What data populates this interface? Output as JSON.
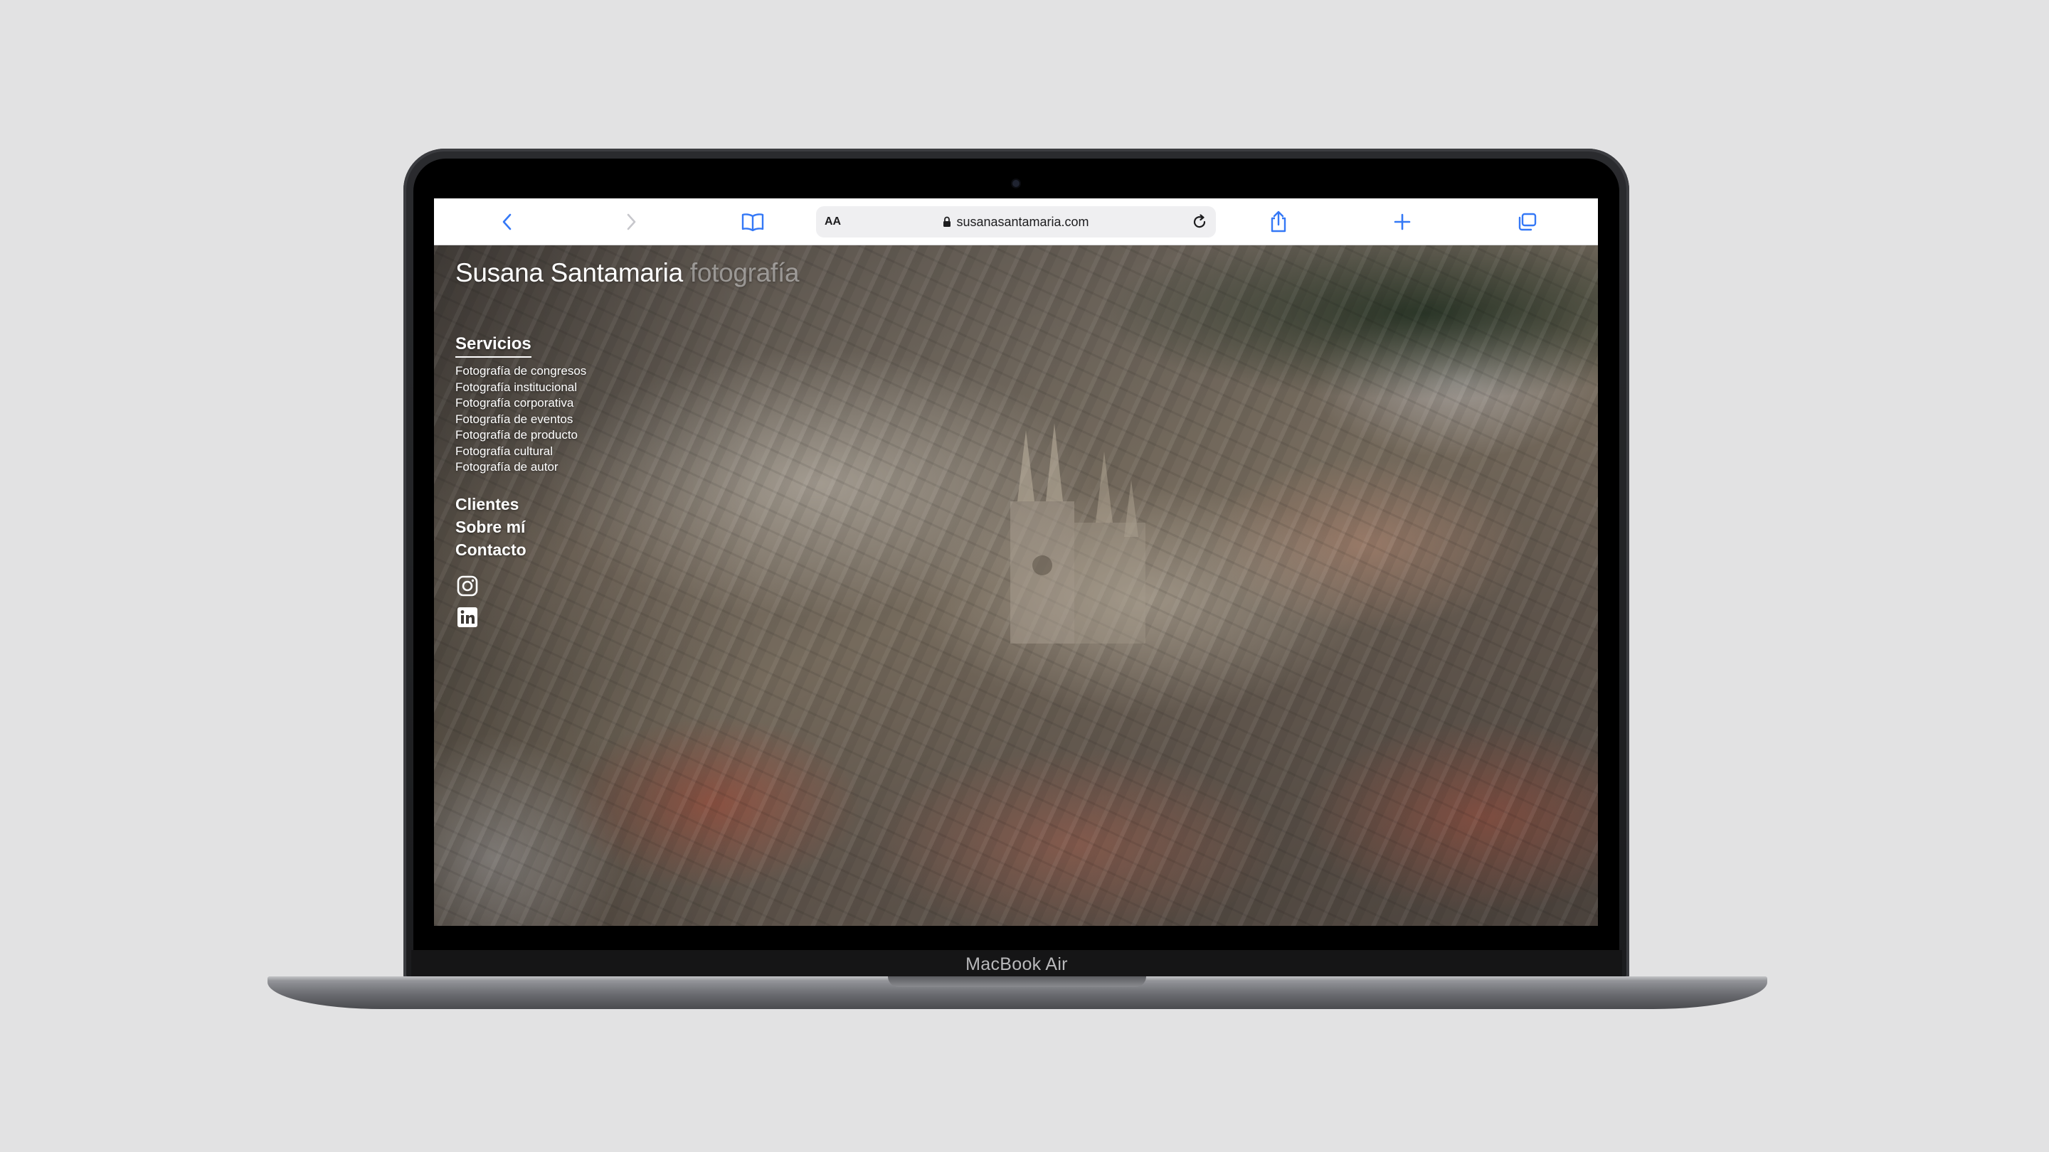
{
  "device": {
    "model_label": "MacBook Air"
  },
  "browser": {
    "text_size_label": "AA",
    "url": "susanasantamaria.com",
    "icons": [
      "back-icon",
      "forward-icon",
      "bookmarks-icon",
      "lock-icon",
      "reload-icon",
      "share-icon",
      "new-tab-icon",
      "tabs-icon"
    ],
    "accent_color": "#3478f6"
  },
  "site": {
    "title": "Susana Santamaria",
    "title_suffix": "fotografía",
    "hero_image": "aerial-cathedral-city-winter",
    "nav": {
      "services_heading": "Servicios",
      "services": [
        "Fotografía de congresos",
        "Fotografía institucional",
        "Fotografía corporativa",
        "Fotografía de eventos",
        "Fotografía de producto",
        "Fotografía cultural",
        "Fotografía de autor"
      ],
      "links": [
        "Clientes",
        "Sobre mí",
        "Contacto"
      ]
    },
    "socials": [
      "instagram-icon",
      "linkedin-icon"
    ]
  }
}
